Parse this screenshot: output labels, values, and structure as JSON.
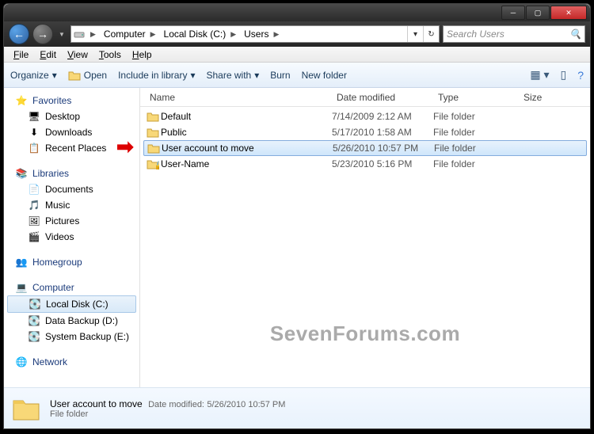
{
  "title_buttons": {
    "min": "min",
    "max": "max",
    "close": "close"
  },
  "breadcrumb": [
    "Computer",
    "Local Disk (C:)",
    "Users"
  ],
  "search_placeholder": "Search Users",
  "menubar": [
    "File",
    "Edit",
    "View",
    "Tools",
    "Help"
  ],
  "toolbar": {
    "organize": "Organize",
    "open": "Open",
    "include": "Include in library",
    "share": "Share with",
    "burn": "Burn",
    "newfolder": "New folder"
  },
  "sidebar": {
    "favorites": {
      "label": "Favorites",
      "items": [
        "Desktop",
        "Downloads",
        "Recent Places"
      ]
    },
    "libraries": {
      "label": "Libraries",
      "items": [
        "Documents",
        "Music",
        "Pictures",
        "Videos"
      ]
    },
    "homegroup": {
      "label": "Homegroup"
    },
    "computer": {
      "label": "Computer",
      "items": [
        "Local Disk (C:)",
        "Data Backup (D:)",
        "System Backup (E:)"
      ]
    },
    "network": {
      "label": "Network"
    }
  },
  "columns": {
    "name": "Name",
    "date": "Date modified",
    "type": "Type",
    "size": "Size"
  },
  "rows": [
    {
      "name": "Default",
      "date": "7/14/2009 2:12 AM",
      "type": "File folder",
      "selected": false,
      "locked": false
    },
    {
      "name": "Public",
      "date": "5/17/2010 1:58 AM",
      "type": "File folder",
      "selected": false,
      "locked": false
    },
    {
      "name": "User account to move",
      "date": "5/26/2010 10:57 PM",
      "type": "File folder",
      "selected": true,
      "locked": false
    },
    {
      "name": "User-Name",
      "date": "5/23/2010 5:16 PM",
      "type": "File folder",
      "selected": false,
      "locked": true
    }
  ],
  "details": {
    "name": "User account to move",
    "meta_label": "Date modified:",
    "meta_value": "5/26/2010 10:57 PM",
    "type": "File folder"
  },
  "watermark": "SevenForums.com"
}
